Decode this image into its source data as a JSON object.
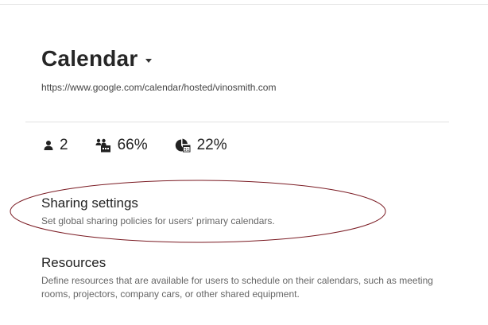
{
  "header": {
    "title": "Calendar",
    "url": "https://www.google.com/calendar/hosted/vinosmith.com"
  },
  "stats": [
    {
      "icon": "user-icon",
      "value": "2"
    },
    {
      "icon": "calendar-users-icon",
      "value": "66%"
    },
    {
      "icon": "calendar-chart-icon",
      "value": "22%"
    }
  ],
  "sections": {
    "sharing": {
      "title": "Sharing settings",
      "description": "Set global sharing policies for users' primary calendars."
    },
    "resources": {
      "title": "Resources",
      "description": "Define resources that are available for users to schedule on their calendars, such as meeting rooms, projectors, company cars, or other shared equipment."
    }
  },
  "colors": {
    "annotation_ellipse": "#7a1a22",
    "divider": "#e2e2e2"
  }
}
